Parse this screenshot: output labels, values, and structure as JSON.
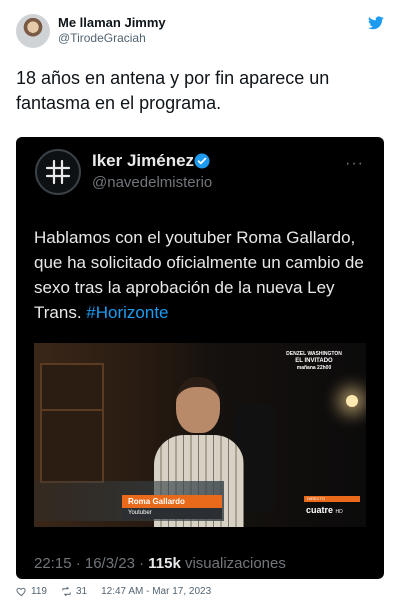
{
  "author": {
    "name": "Me llaman Jimmy",
    "handle": "@TirodeGraciah"
  },
  "tweet_text": "18 años en antena y por fin aparece un fantasma en el programa.",
  "embedded_tweet": {
    "name": "Iker Jiménez",
    "handle": "@navedelmisterio",
    "more": "···",
    "text": "Hablamos con el youtuber Roma Gallardo, que ha solicitado oficialmente un cambio de sexo tras la aprobación de la nueva Ley Trans. ",
    "hashtag": "#Horizonte",
    "meta_time": "22:15 · 16/3/23 · ",
    "meta_views": "115k",
    "meta_views_label": " visualizaciones",
    "video": {
      "promo_line1": "DENZEL WASHINGTON",
      "promo_line2": "EL INVITADO",
      "promo_line3": "mañana 22h00",
      "nameplate": "Roma Gallardo",
      "role": "Youtuber",
      "live_label": "DIRECTO",
      "channel": "cuatre",
      "channel_suffix": "HD"
    }
  },
  "footer": {
    "likes": "119",
    "retweets": "31",
    "timestamp": "12:47 AM - Mar 17, 2023"
  },
  "colors": {
    "brand_blue": "#1d9bf0",
    "nameplate_orange": "#e86a1a"
  },
  "icons": {
    "platform": "twitter-bird-icon",
    "verified": "verified-badge-icon",
    "like": "heart-icon",
    "retweet": "retweet-icon"
  }
}
